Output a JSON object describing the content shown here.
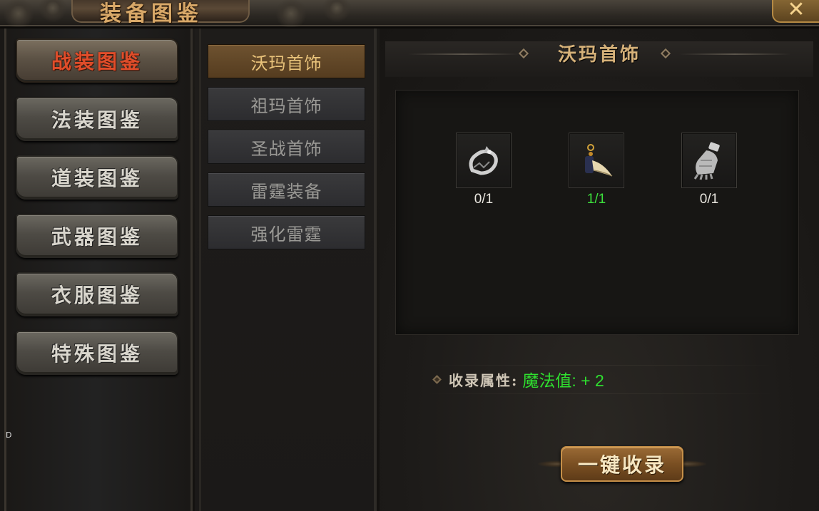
{
  "window": {
    "title": "装备图鉴",
    "close_icon": "close-x-icon"
  },
  "categories": [
    {
      "label": "战装图鉴",
      "active": true
    },
    {
      "label": "法装图鉴",
      "active": false
    },
    {
      "label": "道装图鉴",
      "active": false
    },
    {
      "label": "武器图鉴",
      "active": false
    },
    {
      "label": "衣服图鉴",
      "active": false
    },
    {
      "label": "特殊图鉴",
      "active": false
    }
  ],
  "subcategories": [
    {
      "label": "沃玛首饰",
      "active": true
    },
    {
      "label": "祖玛首饰",
      "active": false
    },
    {
      "label": "圣战首饰",
      "active": false
    },
    {
      "label": "雷霆装备",
      "active": false
    },
    {
      "label": "强化雷霆",
      "active": false
    }
  ],
  "panel": {
    "title": "沃玛首饰",
    "items": [
      {
        "icon": "dragon-bracelet-icon",
        "count": "0/1",
        "complete": false
      },
      {
        "icon": "fang-necklace-icon",
        "count": "1/1",
        "complete": true
      },
      {
        "icon": "gauntlet-icon",
        "count": "0/1",
        "complete": false
      }
    ],
    "attribute_label": "收录属性:",
    "attribute_value": "魔法值: + 2",
    "collect_button": "一键收录"
  },
  "side_marker": "D",
  "colors": {
    "active_category_text": "#e04d2a",
    "active_sub_bg": "#6e5230",
    "title_gold": "#d5b179",
    "complete_green": "#3ce03c",
    "attr_green": "#2fe02f"
  }
}
